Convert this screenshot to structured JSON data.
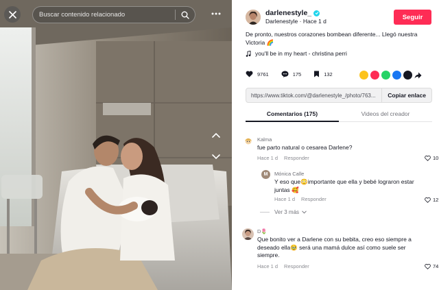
{
  "search": {
    "placeholder": "Buscar contenido relacionado"
  },
  "post": {
    "username": "darlenestyle_",
    "nickname": "Darlenestyle",
    "time": "Hace 1 d",
    "follow_label": "Seguir",
    "description": "De pronto, nuestros corazones bombean diferente... Llegó nuestra Victoria 🌈",
    "music": "you'll be in my heart - christina perri",
    "likes": "9761",
    "comments": "175",
    "saves": "132",
    "link": "https://www.tiktok.com/@darlenestyle_/photo/763...",
    "copy_label": "Copiar enlace"
  },
  "tabs": {
    "comments": "Comentarios (175)",
    "creator_videos": "Videos del creador"
  },
  "comments": [
    {
      "name": "Kalma",
      "text": "fue parto natural o cesarea Darlene?",
      "time": "Hace 1 d",
      "reply_label": "Responder",
      "likes": "10"
    },
    {
      "name": "Mónica Calle",
      "avatar_letter": "M",
      "text": "Y eso que😳importante que ella y bebé lograron estar juntas 🥰",
      "time": "Hace 1 d",
      "reply_label": "Responder",
      "likes": "12"
    },
    {
      "name": "D🌷",
      "text": "Que bonito ver a Darlene con su bebita, creo eso siempre a deseado ella🥹 será una mamá dulce así como suele ser siempre.",
      "time": "Hace 1 d",
      "reply_label": "Responder",
      "likes": "74"
    }
  ],
  "more_replies": "Ver 3 más",
  "colors": {
    "follow": "#fe2c55",
    "verified": "#20d5ec",
    "text": "#161823",
    "muted": "#73747b"
  },
  "share_icons": [
    "embed-icon",
    "send-icon",
    "whatsapp-icon",
    "facebook-icon",
    "x-icon",
    "forward-icon"
  ]
}
